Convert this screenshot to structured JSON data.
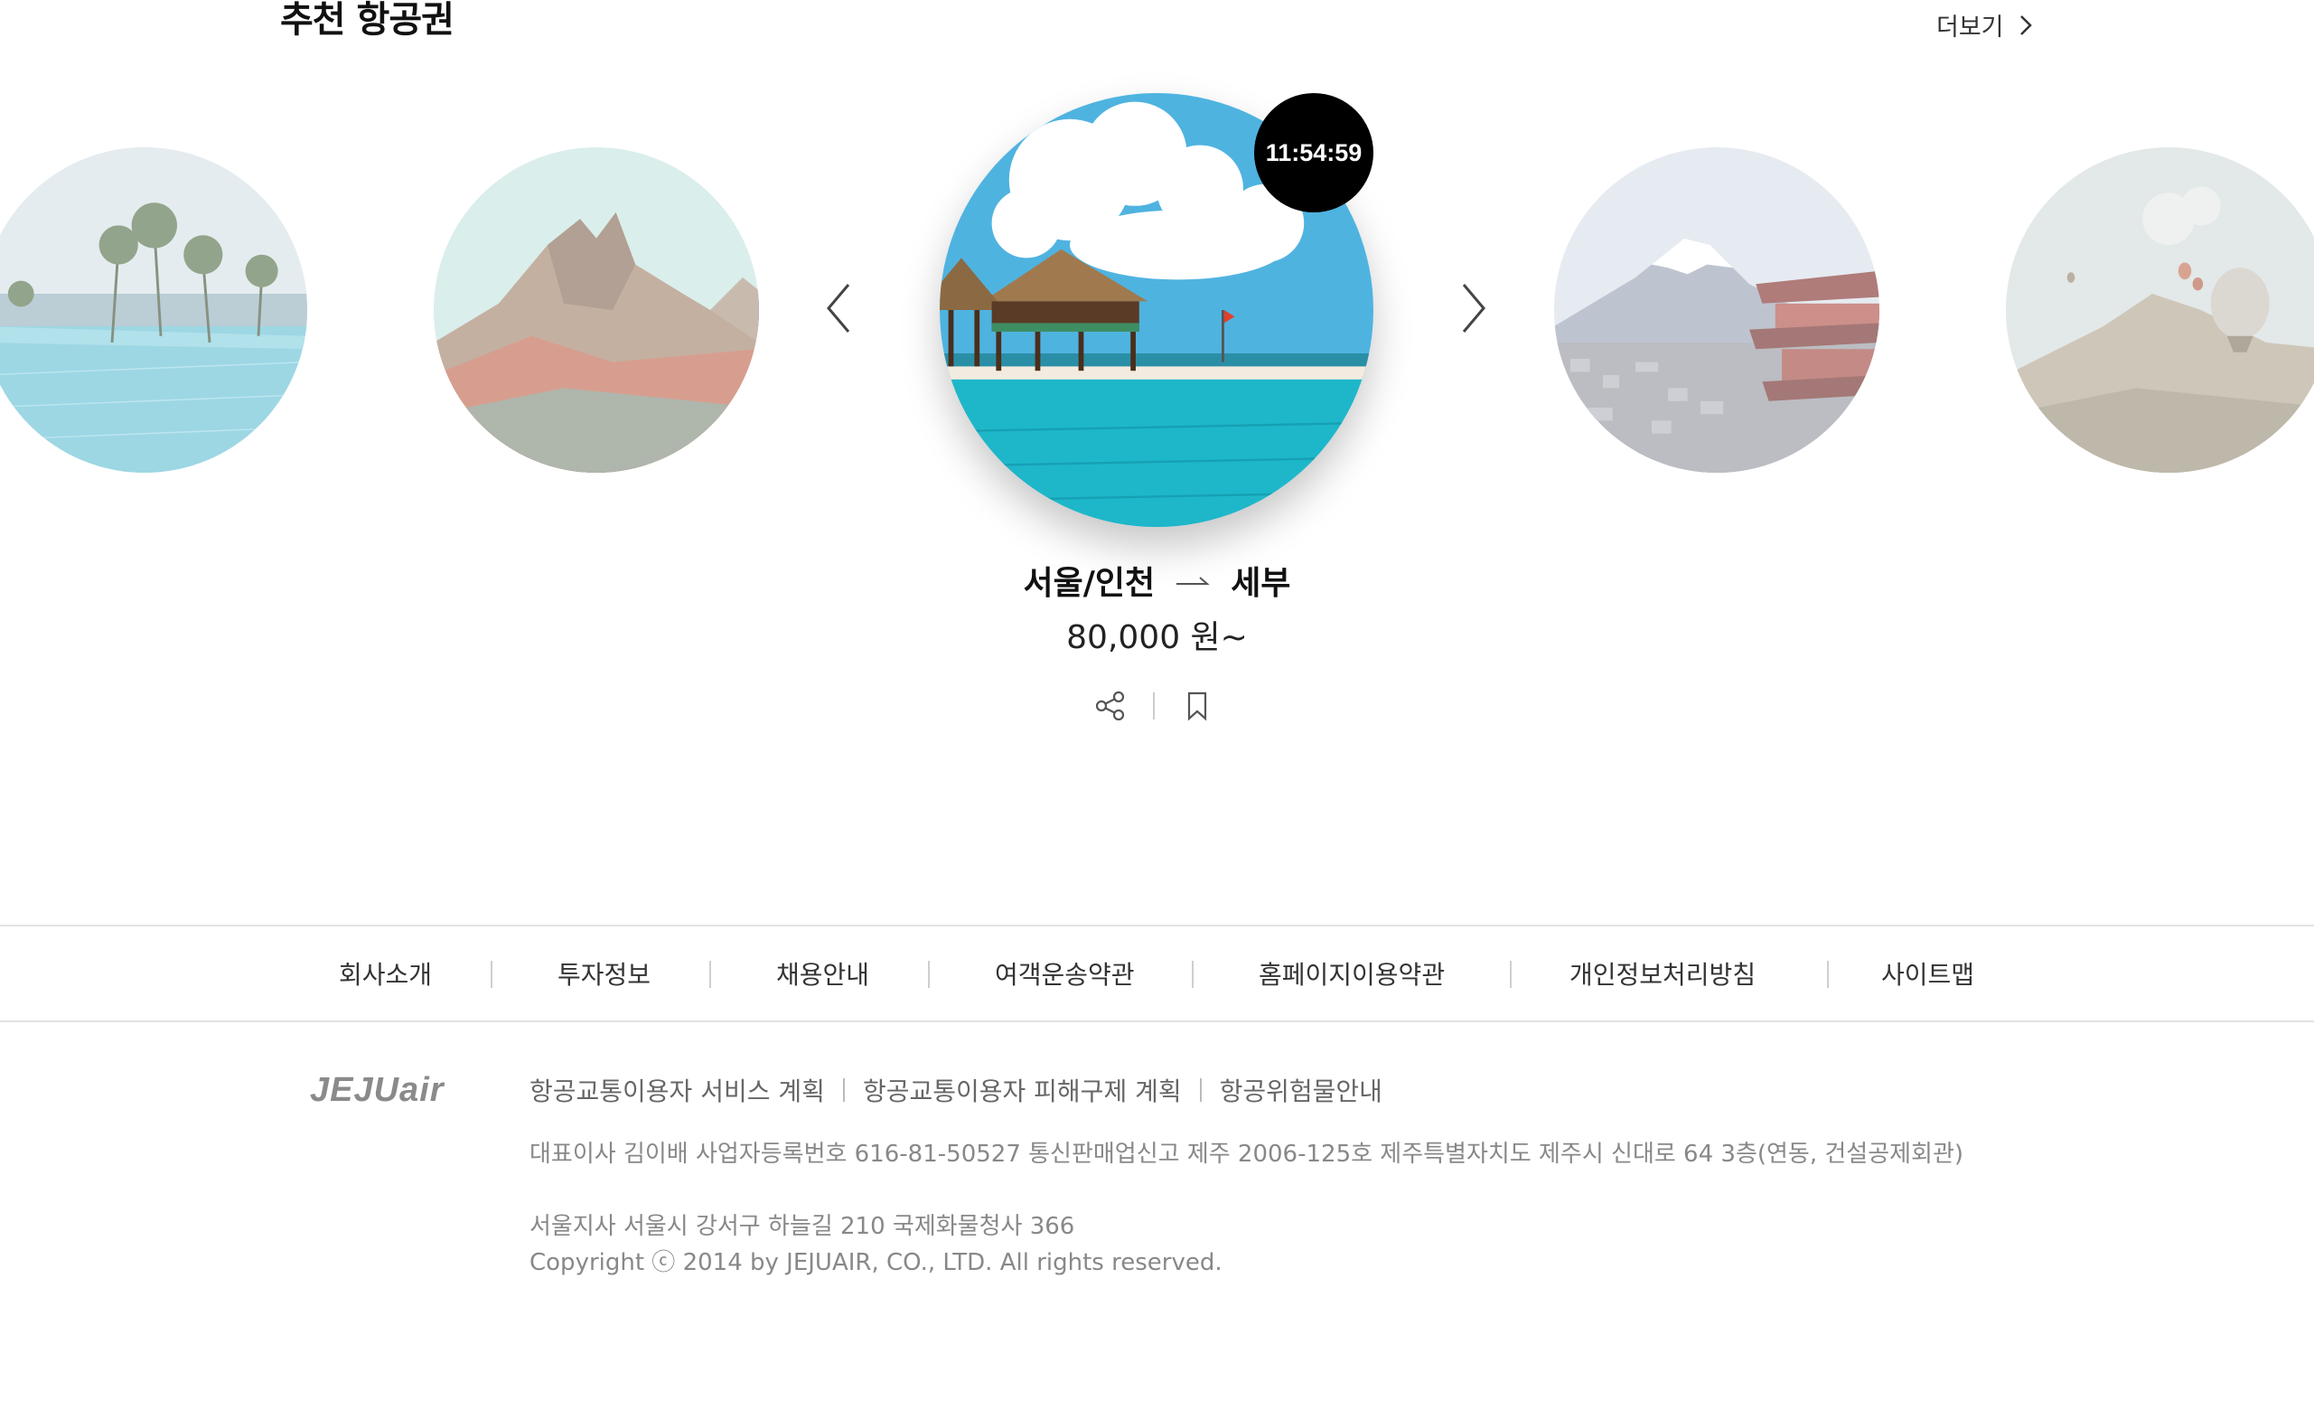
{
  "section": {
    "title": "추천 항공권",
    "more_label": "더보기"
  },
  "carousel": {
    "featured": {
      "timer": "11:54:59",
      "origin": "서울/인천",
      "destination": "세부",
      "price": "80,000 원~"
    },
    "icons": [
      "chevron-left-icon",
      "chevron-right-icon",
      "share-icon",
      "bookmark-icon"
    ]
  },
  "footer": {
    "nav": [
      "회사소개",
      "투자정보",
      "채용안내",
      "여객운송약관",
      "홈페이지이용약관",
      "개인정보처리방침",
      "사이트맵"
    ],
    "logo": "JEJUair",
    "links": [
      "항공교통이용자 서비스 계획",
      "항공교통이용자 피해구제 계획",
      "항공위험물안내"
    ],
    "company_info": "대표이사 김이배 사업자등록번호 616-81-50527 통신판매업신고 제주 2006-125호 제주특별자치도 제주시 신대로 64 3층(연동, 건설공제회관)",
    "seoul_branch": "서울지사 서울시 강서구 하늘길 210 국제화물청사 366",
    "copyright": "Copyright ⓒ 2014 by JEJUAIR, CO., LTD. All rights reserved."
  }
}
